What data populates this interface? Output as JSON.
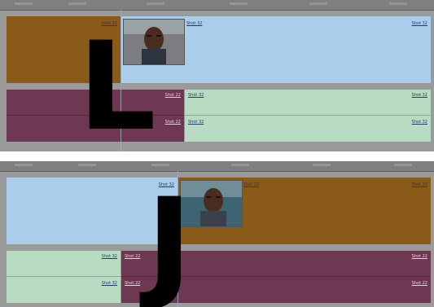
{
  "top_timeline": {
    "clip_brown_label": "Shot 22",
    "clip_blue_label_left": "Shot 32",
    "clip_blue_label_right": "Shot 32",
    "audio_purple_label_1": "Shot 22",
    "audio_purple_label_2": "Shot 22",
    "audio_green_label_left_1": "Shot 32",
    "audio_green_label_left_2": "Shot 32",
    "audio_green_label_right_1": "Shot 32",
    "audio_green_label_right_2": "Shot 32",
    "overlay_letter": "L"
  },
  "bottom_timeline": {
    "clip_blue_label": "Shot 32",
    "clip_brown_label_left": "Shot 22",
    "clip_brown_label_right": "Shot 22",
    "audio_green_label_1": "Shot 32",
    "audio_green_label_2": "Shot 32",
    "audio_purple_label_left_1": "Shot 22",
    "audio_purple_label_left_2": "Shot 22",
    "audio_purple_label_right_1": "Shot 22",
    "audio_purple_label_right_2": "Shot 22",
    "overlay_letter": "J"
  },
  "colors": {
    "video_brown": "#8a5a18",
    "video_blue": "#a9cdea",
    "audio_purple": "#6e3752",
    "audio_green": "#b7dcc1",
    "track_gray": "#9a9a9a"
  }
}
